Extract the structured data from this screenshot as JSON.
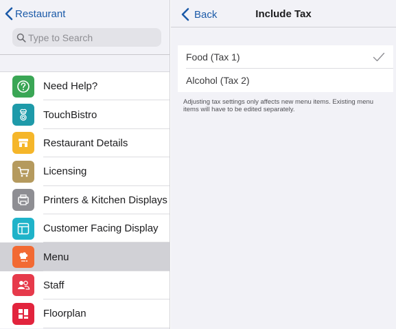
{
  "left_nav": {
    "back_label": "Restaurant",
    "search_placeholder": "Type to Search"
  },
  "menu_items": [
    {
      "label": "Need Help?",
      "icon": "question-icon",
      "color": "#3aa655"
    },
    {
      "label": "TouchBistro",
      "icon": "touchbistro-chef-icon",
      "color": "#1e9aa9"
    },
    {
      "label": "Restaurant Details",
      "icon": "storefront-icon",
      "color": "#f5b62a"
    },
    {
      "label": "Licensing",
      "icon": "cart-icon",
      "color": "#b59a5e"
    },
    {
      "label": "Printers & Kitchen Displays",
      "icon": "printer-icon",
      "color": "#8e8e93"
    },
    {
      "label": "Customer Facing Display",
      "icon": "display-layout-icon",
      "color": "#1fb3c9"
    },
    {
      "label": "Menu",
      "icon": "chef-hat-icon",
      "color": "#f26a33"
    },
    {
      "label": "Staff",
      "icon": "staff-people-icon",
      "color": "#e63a4b"
    },
    {
      "label": "Floorplan",
      "icon": "floorplan-icon",
      "color": "#e2243d"
    }
  ],
  "detail": {
    "back_label": "Back",
    "title": "Include Tax",
    "options": [
      {
        "label": "Food (Tax 1)",
        "checked": true
      },
      {
        "label": "Alcohol (Tax 2)",
        "checked": false
      }
    ],
    "footnote": "Adjusting tax settings only affects new menu items. Existing menu items will have to be edited separately."
  },
  "colors": {
    "accent": "#1b5aa8",
    "selected_row": "#d1d1d6",
    "check": "#8e8e93"
  }
}
